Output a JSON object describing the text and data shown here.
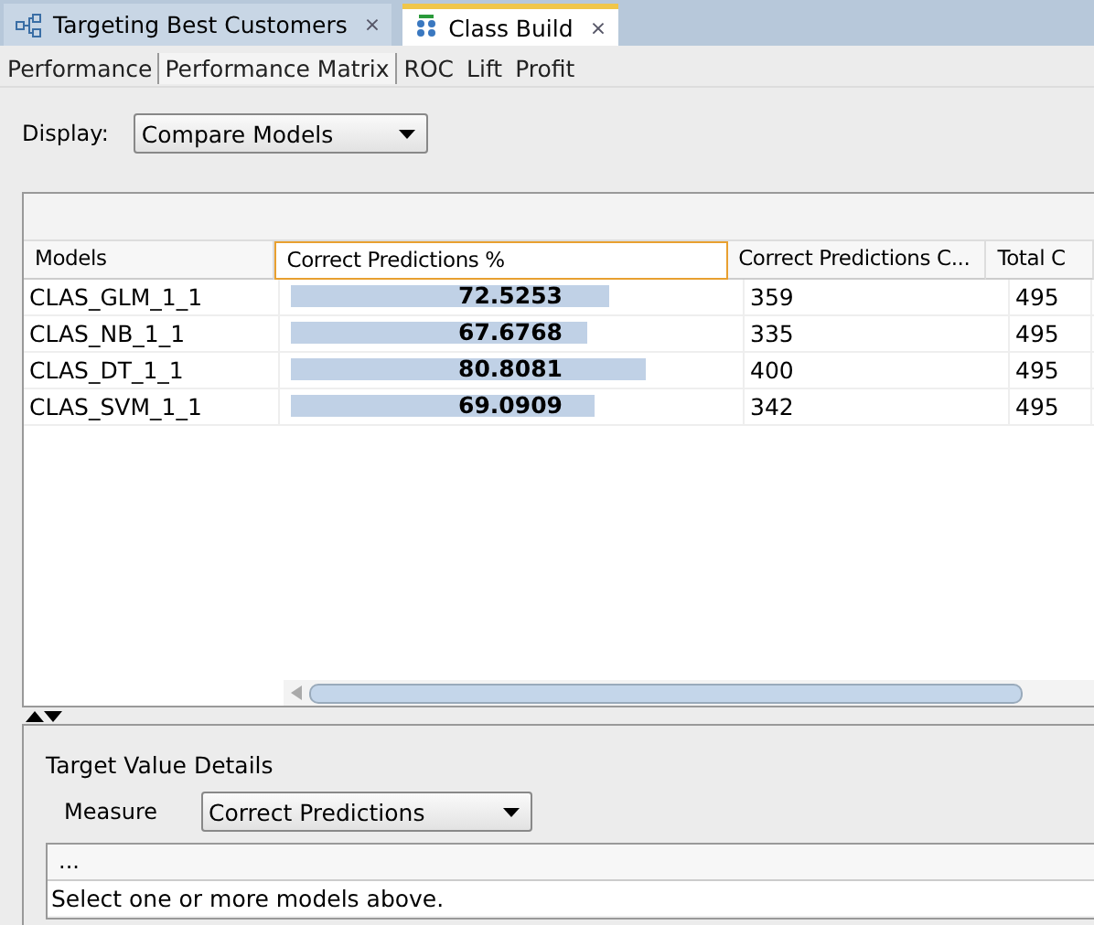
{
  "editor_tabs": [
    {
      "label": "Targeting Best Customers",
      "selected": false
    },
    {
      "label": "Class Build",
      "selected": true
    }
  ],
  "close_glyph": "×",
  "view_tabs": [
    {
      "label": "Performance",
      "selected": false
    },
    {
      "label": "Performance Matrix",
      "selected": true
    },
    {
      "label": "ROC",
      "selected": false
    },
    {
      "label": "Lift",
      "selected": false
    },
    {
      "label": "Profit",
      "selected": false
    }
  ],
  "display": {
    "label": "Display:",
    "value": "Compare Models"
  },
  "table": {
    "columns": [
      {
        "label": "Models",
        "selected": false
      },
      {
        "label": "Correct Predictions %",
        "selected": true
      },
      {
        "label": "Correct Predictions C...",
        "selected": false
      },
      {
        "label": "Total C",
        "selected": false
      }
    ],
    "rows": [
      {
        "model": "CLAS_GLM_1_1",
        "percent": "72.5253",
        "level": 0.725253,
        "correct": "359",
        "total": "495"
      },
      {
        "model": "CLAS_NB_1_1",
        "percent": "67.6768",
        "level": 0.676768,
        "correct": "335",
        "total": "495"
      },
      {
        "model": "CLAS_DT_1_1",
        "percent": "80.8081",
        "level": 0.808081,
        "correct": "400",
        "total": "495"
      },
      {
        "model": "CLAS_SVM_1_1",
        "percent": "69.0909",
        "level": 0.690909,
        "correct": "342",
        "total": "495"
      }
    ]
  },
  "details": {
    "title": "Target Value Details",
    "measure_label": "Measure",
    "measure_value": "Correct Predictions",
    "header": "...",
    "message": "Select one or more models above."
  }
}
